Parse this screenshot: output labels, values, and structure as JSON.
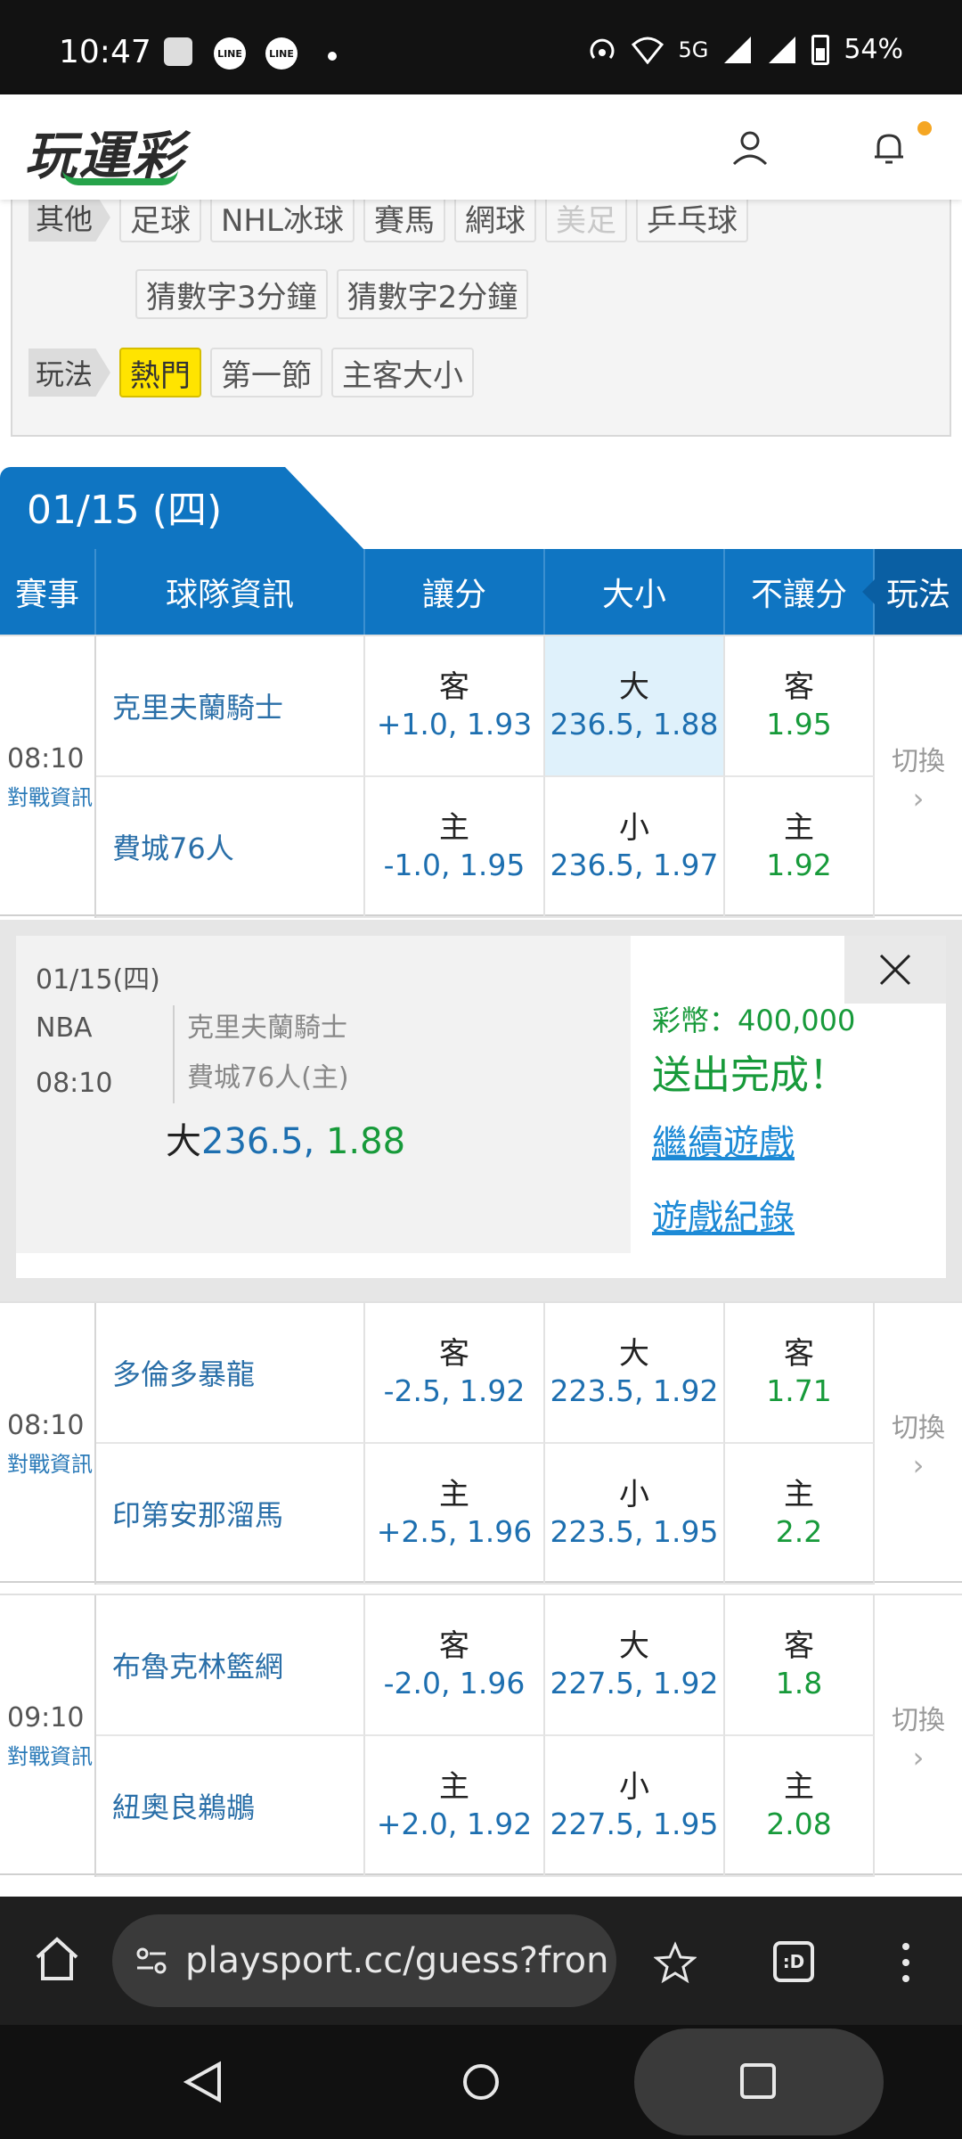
{
  "status_bar": {
    "time": "10:47",
    "app_icons": [
      "photos-icon",
      "line-icon",
      "line-icon"
    ],
    "network": "5G",
    "sim1": "1",
    "sim2": "2",
    "battery": "54%"
  },
  "header": {
    "logo_text": "玩運彩",
    "brand_color": "#26a34a"
  },
  "filters": {
    "other_label": "其他",
    "other_chips": [
      "足球",
      "NHL冰球",
      "賽馬",
      "網球",
      "美足",
      "乒乓球"
    ],
    "other_chips_row2": [
      "猜數字3分鐘",
      "猜數字2分鐘"
    ],
    "play_label": "玩法",
    "play_chips": [
      "熱門",
      "第一節",
      "主客大小"
    ],
    "active_play": "熱門"
  },
  "date_header": "01/15 (四)",
  "columns": [
    "賽事",
    "球隊資訊",
    "讓分",
    "大小",
    "不讓分",
    "玩法"
  ],
  "games": [
    {
      "time": "08:10",
      "info_link": "對戰資訊",
      "switch": "切換",
      "rows": [
        {
          "team": "克里夫蘭騎士",
          "spread_label": "客",
          "spread": "+1.0, 1.93",
          "total_label": "大",
          "total": "236.5, 1.88",
          "ml_label": "客",
          "ml": "1.95"
        },
        {
          "team": "費城76人",
          "spread_label": "主",
          "spread": "-1.0, 1.95",
          "total_label": "小",
          "total": "236.5, 1.97",
          "ml_label": "主",
          "ml": "1.92"
        }
      ]
    },
    {
      "time": "08:10",
      "info_link": "對戰資訊",
      "switch": "切換",
      "rows": [
        {
          "team": "多倫多暴龍",
          "spread_label": "客",
          "spread": "-2.5, 1.92",
          "total_label": "大",
          "total": "223.5, 1.92",
          "ml_label": "客",
          "ml": "1.71"
        },
        {
          "team": "印第安那溜馬",
          "spread_label": "主",
          "spread": "+2.5, 1.96",
          "total_label": "小",
          "total": "223.5, 1.95",
          "ml_label": "主",
          "ml": "2.2"
        }
      ]
    },
    {
      "time": "09:10",
      "info_link": "對戰資訊",
      "switch": "切換",
      "rows": [
        {
          "team": "布魯克林籃網",
          "spread_label": "客",
          "spread": "-2.0, 1.96",
          "total_label": "大",
          "total": "227.5, 1.92",
          "ml_label": "客",
          "ml": "1.8"
        },
        {
          "team": "紐奧良鵜鶘",
          "spread_label": "主",
          "spread": "+2.0, 1.92",
          "total_label": "小",
          "total": "227.5, 1.95",
          "ml_label": "主",
          "ml": "2.08"
        }
      ]
    }
  ],
  "popup": {
    "date": "01/15(四)",
    "league": "NBA",
    "time": "08:10",
    "team1": "克里夫蘭騎士",
    "team2": "費城76人(主)",
    "pick_label": "大",
    "pick_value": "236.5",
    "pick_sep": ",",
    "pick_odds": " 1.88",
    "coins": "彩幣：400,000",
    "status": "送出完成！",
    "continue": "繼續遊戲",
    "history": "遊戲紀錄"
  },
  "browser": {
    "url": "playsport.cc/guess?fron",
    "tab_label": ":D"
  },
  "colors": {
    "table_header": "#0f75c2",
    "odds_blue": "#1d6fb0",
    "odds_green": "#179a3a",
    "active_chip": "#ffe400"
  }
}
